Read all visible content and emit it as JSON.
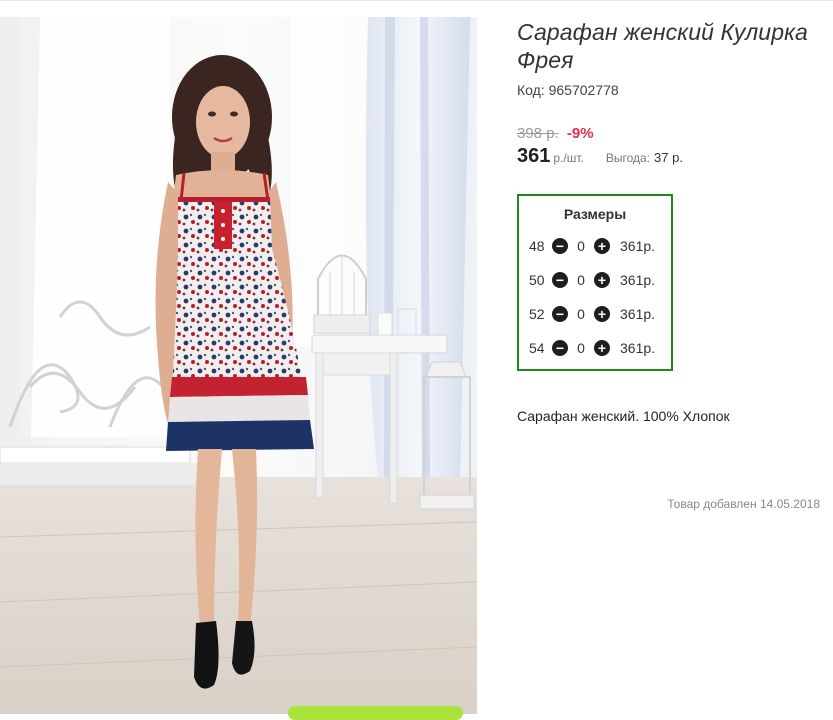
{
  "product": {
    "title": "Сарафан женский Кулирка Фрея",
    "code_label": "Код:",
    "code_value": "965702778",
    "description": "Сарафан женский. 100% Хлопок",
    "added": "Товар добавлен 14.05.2018"
  },
  "price": {
    "old": "398 р.",
    "discount": "-9%",
    "current": "361",
    "unit": "р./шт.",
    "savings_label": "Выгода:",
    "savings_value": "37 р."
  },
  "sizes": {
    "title": "Размеры",
    "rows": [
      {
        "size": "48",
        "qty": "0",
        "price": "361р."
      },
      {
        "size": "50",
        "qty": "0",
        "price": "361р."
      },
      {
        "size": "52",
        "qty": "0",
        "price": "361р."
      },
      {
        "size": "54",
        "qty": "0",
        "price": "361р."
      }
    ]
  },
  "icons": {
    "minus": "minus-circle-icon",
    "plus": "plus-circle-icon"
  },
  "colors": {
    "frame": "#1d8a1d",
    "discount": "#e2304a",
    "buy_button": "#a9e33c"
  }
}
